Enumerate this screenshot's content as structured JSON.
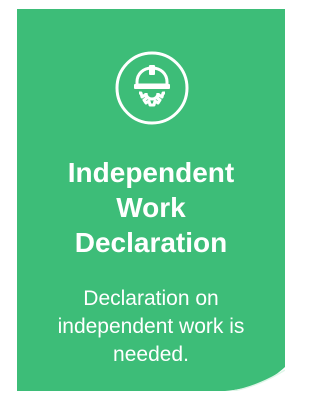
{
  "card": {
    "icon": "hardhat-gear-icon",
    "title_lines": [
      "Independent",
      "Work",
      "Declaration"
    ],
    "description_lines": [
      "Declaration on",
      "independent work is",
      "needed."
    ],
    "background_color": "#3dbd78",
    "text_color": "#ffffff"
  }
}
